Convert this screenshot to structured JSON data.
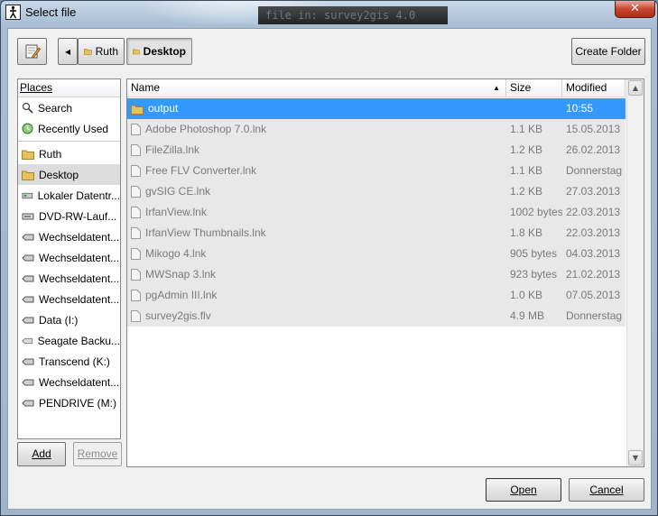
{
  "window": {
    "title": "Select file",
    "background_terminal_text": "file in: survey2gis 4.0",
    "close_label": "✕"
  },
  "toolbar": {
    "edit_icon": "pencil-icon",
    "back_label": "◂",
    "breadcrumbs": [
      {
        "label": "Ruth",
        "icon": "folder-icon",
        "selected": false
      },
      {
        "label": "Desktop",
        "icon": "folder-icon",
        "selected": true
      }
    ],
    "create_folder_label": "Create Folder"
  },
  "places": {
    "header": "Places",
    "items": [
      {
        "label": "Search",
        "icon": "magnifier-icon"
      },
      {
        "label": "Recently Used",
        "icon": "recent-icon"
      },
      {
        "separator": true
      },
      {
        "label": "Ruth",
        "icon": "folder-icon"
      },
      {
        "label": "Desktop",
        "icon": "folder-icon",
        "selected": true
      },
      {
        "label": "Lokaler Datentr...",
        "icon": "drive-icon"
      },
      {
        "label": "DVD-RW-Lauf...",
        "icon": "optical-drive-icon"
      },
      {
        "label": "Wechseldatent...",
        "icon": "removable-drive-icon"
      },
      {
        "label": "Wechseldatent...",
        "icon": "removable-drive-icon"
      },
      {
        "label": "Wechseldatent...",
        "icon": "removable-drive-icon"
      },
      {
        "label": "Wechseldatent...",
        "icon": "removable-drive-icon"
      },
      {
        "label": "Data (I:)",
        "icon": "removable-drive-icon"
      },
      {
        "label": "Seagate Backu...",
        "icon": "removable-drive-icon"
      },
      {
        "label": "Transcend (K:)",
        "icon": "removable-drive-icon"
      },
      {
        "label": "Wechseldatent...",
        "icon": "removable-drive-icon"
      },
      {
        "label": "PENDRIVE (M:)",
        "icon": "removable-drive-icon"
      }
    ],
    "add_label": "Add",
    "remove_label": "Remove"
  },
  "files": {
    "columns": {
      "name": "Name",
      "size": "Size",
      "modified": "Modified"
    },
    "rows": [
      {
        "name": "output",
        "size": "",
        "modified": "10:55",
        "type": "folder",
        "selected": true
      },
      {
        "name": "Adobe Photoshop 7.0.lnk",
        "size": "1.1 KB",
        "modified": "15.05.2013",
        "type": "file"
      },
      {
        "name": "FileZilla.lnk",
        "size": "1.2 KB",
        "modified": "26.02.2013",
        "type": "file"
      },
      {
        "name": "Free FLV Converter.lnk",
        "size": "1.1 KB",
        "modified": "Donnerstag",
        "type": "file"
      },
      {
        "name": "gvSIG CE.lnk",
        "size": "1.2 KB",
        "modified": "27.03.2013",
        "type": "file"
      },
      {
        "name": "IrfanView.lnk",
        "size": "1002 bytes",
        "modified": "22.03.2013",
        "type": "file"
      },
      {
        "name": "IrfanView Thumbnails.lnk",
        "size": "1.8 KB",
        "modified": "22.03.2013",
        "type": "file"
      },
      {
        "name": "Mikogo 4.lnk",
        "size": "905 bytes",
        "modified": "04.03.2013",
        "type": "file"
      },
      {
        "name": "MWSnap 3.lnk",
        "size": "923 bytes",
        "modified": "21.02.2013",
        "type": "file"
      },
      {
        "name": "pgAdmin III.lnk",
        "size": "1.0 KB",
        "modified": "07.05.2013",
        "type": "file"
      },
      {
        "name": "survey2gis.flv",
        "size": "4.9 MB",
        "modified": "Donnerstag",
        "type": "file"
      }
    ]
  },
  "actions": {
    "open_label": "Open",
    "cancel_label": "Cancel"
  },
  "colors": {
    "selection": "#3399ff",
    "folder": "#e8c15a"
  }
}
